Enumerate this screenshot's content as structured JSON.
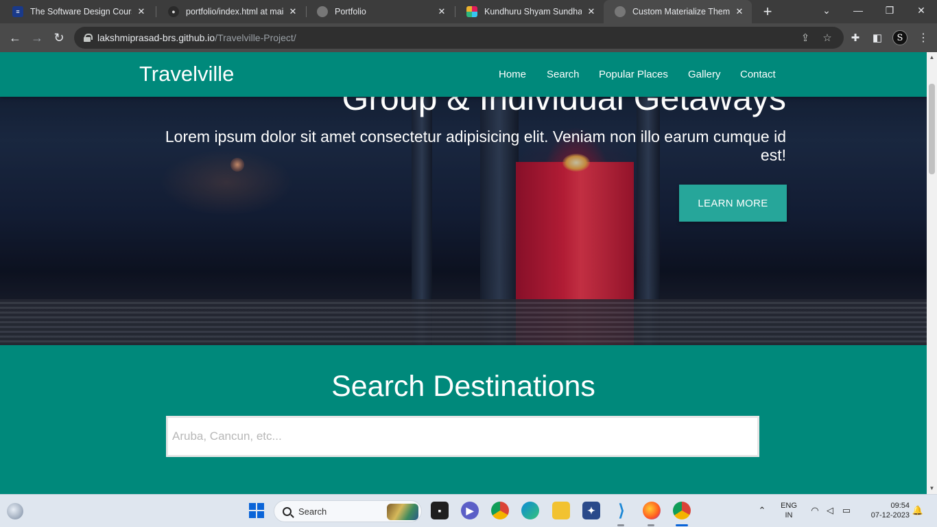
{
  "browser": {
    "tabs": [
      {
        "title": "The Software Design Course",
        "favicon": "course-icon",
        "active": false
      },
      {
        "title": "portfolio/index.html at main",
        "favicon": "github-icon",
        "active": false
      },
      {
        "title": "Portfolio",
        "favicon": "globe-icon",
        "active": false
      },
      {
        "title": "Kundhuru Shyam Sundhar -",
        "favicon": "slack-icon",
        "active": false
      },
      {
        "title": "Custom Materialize Theme",
        "favicon": "globe-icon",
        "active": true
      }
    ],
    "url_host": "lakshmiprasad-brs.github.io",
    "url_path": "/Travelville-Project/",
    "profile_initial": "S"
  },
  "site": {
    "brand": "Travelville",
    "nav": [
      "Home",
      "Search",
      "Popular Places",
      "Gallery",
      "Contact"
    ],
    "hero": {
      "heading": "Group & Individual Getaways",
      "text": "Lorem ipsum dolor sit amet consectetur adipisicing elit. Veniam non illo earum cumque id est!",
      "button": "LEARN MORE"
    },
    "search": {
      "title": "Search Destinations",
      "placeholder": "Aruba, Cancun, etc..."
    },
    "theme_color": "#00897b",
    "button_color": "#26a69a"
  },
  "taskbar": {
    "search_label": "Search",
    "language": "ENG",
    "region": "IN",
    "time": "09:54",
    "date": "07-12-2023"
  }
}
